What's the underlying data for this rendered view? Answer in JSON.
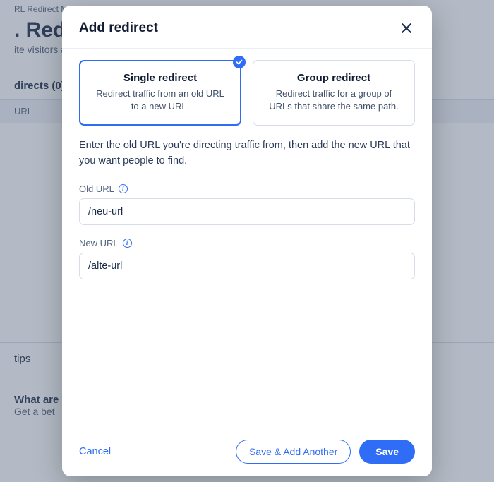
{
  "background": {
    "crumb": "RL Redirect Manager",
    "title": ". Redire",
    "subtitle": "ite visitors an",
    "manage_heading": "directs (0)",
    "table_col": "URL",
    "tips_heading": "tips",
    "tips_q": "What are",
    "tips_sub": "Get a bet"
  },
  "modal": {
    "title": "Add redirect",
    "options": {
      "single": {
        "title": "Single redirect",
        "desc": "Redirect traffic from an old URL to a new URL."
      },
      "group": {
        "title": "Group redirect",
        "desc": "Redirect traffic for a group of URLs that share the same path."
      }
    },
    "instructions": "Enter the old URL you're directing traffic from, then add the new URL that you want people to find.",
    "fields": {
      "old_url": {
        "label": "Old URL",
        "value": "/neu-url"
      },
      "new_url": {
        "label": "New URL",
        "value": "/alte-url"
      }
    },
    "buttons": {
      "cancel": "Cancel",
      "save_add": "Save & Add Another",
      "save": "Save"
    }
  }
}
